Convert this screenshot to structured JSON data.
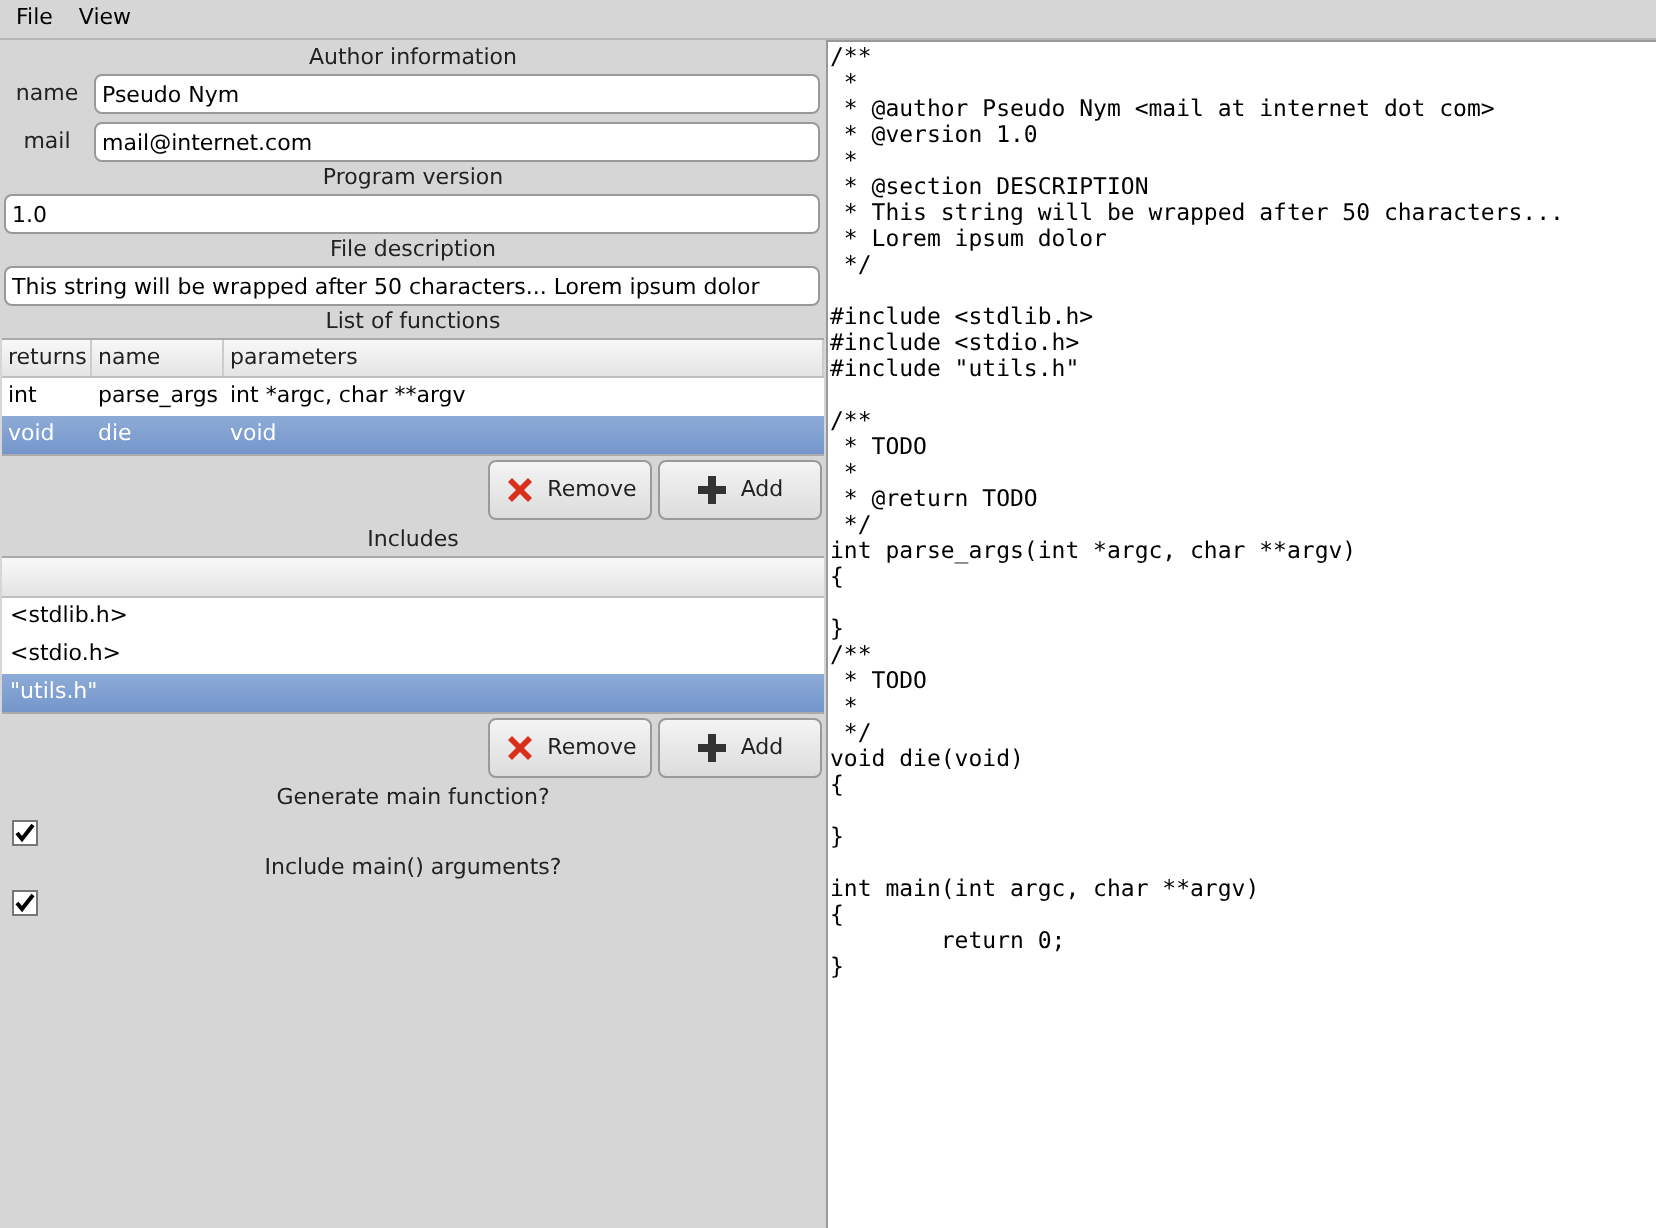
{
  "menu": [
    "File",
    "View"
  ],
  "author": {
    "title": "Author information",
    "fields": [
      {
        "label": "name",
        "value": "Pseudo Nym"
      },
      {
        "label": "mail",
        "value": "mail@internet.com"
      }
    ]
  },
  "version": {
    "title": "Program version",
    "value": "1.0"
  },
  "description": {
    "title": "File description",
    "value": "This string will be wrapped after 50 characters... Lorem ipsum dolor"
  },
  "functions": {
    "title": "List of functions",
    "columns": [
      "returns",
      "name",
      "parameters"
    ],
    "rows": [
      {
        "cells": [
          "int",
          "parse_args",
          "int *argc, char **argv"
        ],
        "selected": false
      },
      {
        "cells": [
          "void",
          "die",
          "void"
        ],
        "selected": true
      }
    ],
    "buttons": [
      {
        "kind": "remove",
        "label": "Remove"
      },
      {
        "kind": "add",
        "label": "Add"
      }
    ]
  },
  "includes": {
    "title": "Includes",
    "rows": [
      {
        "text": "<stdlib.h>",
        "selected": false
      },
      {
        "text": "<stdio.h>",
        "selected": false
      },
      {
        "text": "\"utils.h\"",
        "selected": true
      }
    ],
    "buttons": [
      {
        "kind": "remove",
        "label": "Remove"
      },
      {
        "kind": "add",
        "label": "Add"
      }
    ]
  },
  "options": [
    {
      "label": "Generate main function?",
      "checked": true
    },
    {
      "label": "Include main() arguments?",
      "checked": true
    }
  ],
  "code": "/**\n *\n * @author Pseudo Nym <mail at internet dot com>\n * @version 1.0\n *\n * @section DESCRIPTION\n * This string will be wrapped after 50 characters...\n * Lorem ipsum dolor\n */\n\n#include <stdlib.h>\n#include <stdio.h>\n#include \"utils.h\"\n\n/**\n * TODO\n *\n * @return TODO\n */\nint parse_args(int *argc, char **argv)\n{\n\n}\n/**\n * TODO\n *\n */\nvoid die(void)\n{\n\n}\n\nint main(int argc, char **argv)\n{\n        return 0;\n}"
}
